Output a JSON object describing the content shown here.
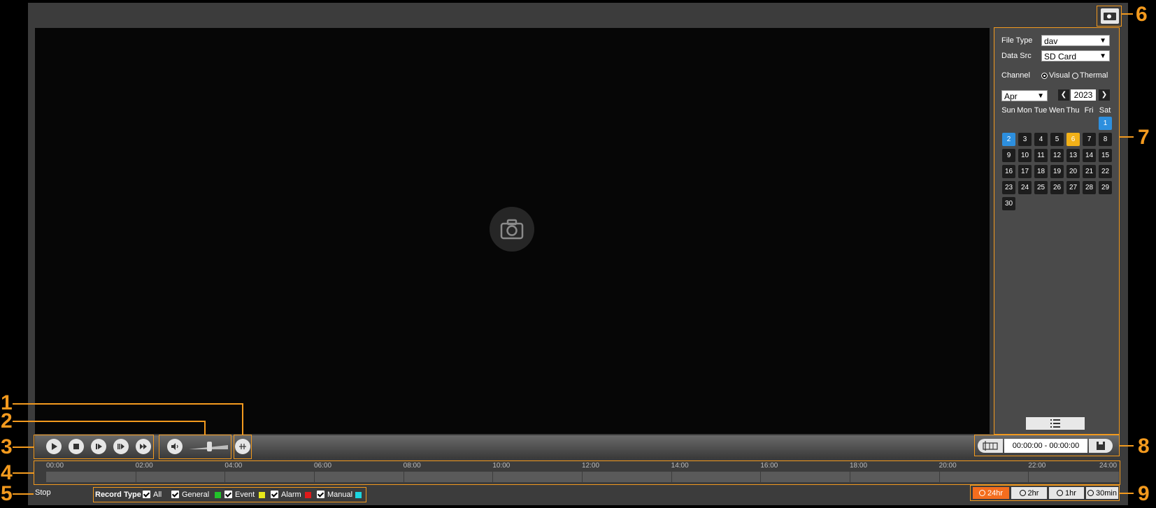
{
  "callouts": [
    "1",
    "2",
    "3",
    "4",
    "5",
    "6",
    "7",
    "8",
    "9"
  ],
  "panel": {
    "file_type_label": "File Type",
    "file_type_value": "dav",
    "data_src_label": "Data Src",
    "data_src_value": "SD Card",
    "channel_label": "Channel",
    "channel_visual": "Visual",
    "channel_thermal": "Thermal",
    "month": "Apr",
    "year": "2023",
    "weekdays": [
      "Sun",
      "Mon",
      "Tue",
      "Wen",
      "Thu",
      "Fri",
      "Sat"
    ],
    "days": [
      "1",
      "2",
      "3",
      "4",
      "5",
      "6",
      "7",
      "8",
      "9",
      "10",
      "11",
      "12",
      "13",
      "14",
      "15",
      "16",
      "17",
      "18",
      "19",
      "20",
      "21",
      "22",
      "23",
      "24",
      "25",
      "26",
      "27",
      "28",
      "29",
      "30"
    ],
    "highlight_blue": [
      "1",
      "2"
    ],
    "highlight_yellow": [
      "6"
    ]
  },
  "controls": {
    "time_range": "00:00:00 - 00:00:00"
  },
  "timeline": {
    "ticks": [
      "00:00",
      "02:00",
      "04:00",
      "06:00",
      "08:00",
      "10:00",
      "12:00",
      "14:00",
      "16:00",
      "18:00",
      "20:00",
      "22:00",
      "24:00"
    ]
  },
  "status": {
    "text": "Stop",
    "record_type_label": "Record Type",
    "types": [
      {
        "label": "All",
        "color": ""
      },
      {
        "label": "General",
        "color": "#22c22a"
      },
      {
        "label": "Event",
        "color": "#e8e81a"
      },
      {
        "label": "Alarm",
        "color": "#e01a1a"
      },
      {
        "label": "Manual",
        "color": "#1ad6e0"
      }
    ]
  },
  "zoom": [
    "24hr",
    "2hr",
    "1hr",
    "30min"
  ],
  "colors": {
    "accent": "#f39a1e",
    "active_zoom": "#f36d1e"
  }
}
